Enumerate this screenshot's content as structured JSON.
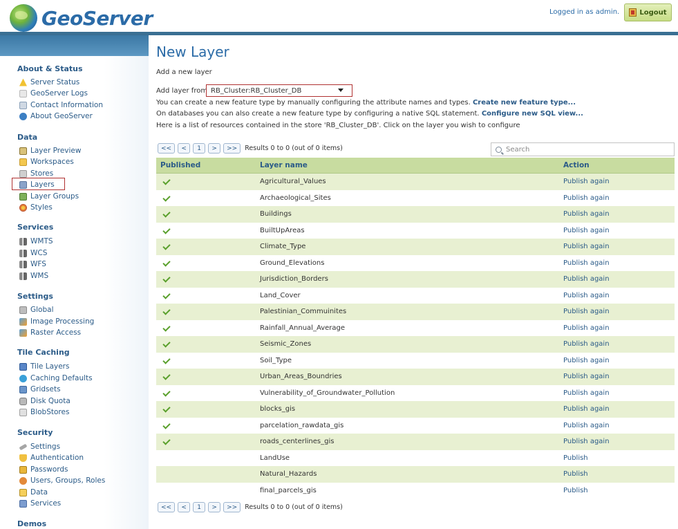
{
  "header": {
    "brand": "GeoServer",
    "logged_in": "Logged in as admin.",
    "logout": "Logout"
  },
  "sidebar": {
    "about": {
      "title": "About & Status",
      "items": [
        "Server Status",
        "GeoServer Logs",
        "Contact Information",
        "About GeoServer"
      ]
    },
    "data": {
      "title": "Data",
      "items": [
        "Layer Preview",
        "Workspaces",
        "Stores",
        "Layers",
        "Layer Groups",
        "Styles"
      ]
    },
    "services": {
      "title": "Services",
      "items": [
        "WMTS",
        "WCS",
        "WFS",
        "WMS"
      ]
    },
    "settings": {
      "title": "Settings",
      "items": [
        "Global",
        "Image Processing",
        "Raster Access"
      ]
    },
    "tile_caching": {
      "title": "Tile Caching",
      "items": [
        "Tile Layers",
        "Caching Defaults",
        "Gridsets",
        "Disk Quota",
        "BlobStores"
      ]
    },
    "security": {
      "title": "Security",
      "items": [
        "Settings",
        "Authentication",
        "Passwords",
        "Users, Groups, Roles",
        "Data",
        "Services"
      ]
    },
    "demos": {
      "title": "Demos"
    }
  },
  "main": {
    "title": "New Layer",
    "subtitle": "Add a new layer",
    "add_from_label": "Add layer from",
    "store_value": "RB_Cluster:RB_Cluster_DB",
    "line1_text": "You can create a new feature type by manually configuring the attribute names and types.",
    "line1_link": "Create new feature type...",
    "line2_text": "On databases you can also create a new feature type by configuring a native SQL statement.",
    "line2_link": "Configure new SQL view...",
    "line3_text": "Here is a list of resources contained in the store 'RB_Cluster_DB'. Click on the layer you wish to configure",
    "pager": {
      "first": "<<",
      "prev": "<",
      "page": "1",
      "next": ">",
      "last": ">>",
      "results": "Results 0 to 0 (out of 0 items)"
    },
    "search_placeholder": "Search",
    "table": {
      "headers": [
        "Published",
        "Layer name",
        "Action"
      ],
      "rows": [
        {
          "published": true,
          "name": "Agricultural_Values",
          "action": "Publish again"
        },
        {
          "published": true,
          "name": "Archaeological_Sites",
          "action": "Publish again"
        },
        {
          "published": true,
          "name": "Buildings",
          "action": "Publish again"
        },
        {
          "published": true,
          "name": "BuiltUpAreas",
          "action": "Publish again"
        },
        {
          "published": true,
          "name": "Climate_Type",
          "action": "Publish again"
        },
        {
          "published": true,
          "name": "Ground_Elevations",
          "action": "Publish again"
        },
        {
          "published": true,
          "name": "Jurisdiction_Borders",
          "action": "Publish again"
        },
        {
          "published": true,
          "name": "Land_Cover",
          "action": "Publish again"
        },
        {
          "published": true,
          "name": "Palestinian_Commuinites",
          "action": "Publish again"
        },
        {
          "published": true,
          "name": "Rainfall_Annual_Average",
          "action": "Publish again"
        },
        {
          "published": true,
          "name": "Seismic_Zones",
          "action": "Publish again"
        },
        {
          "published": true,
          "name": "Soil_Type",
          "action": "Publish again"
        },
        {
          "published": true,
          "name": "Urban_Areas_Boundries",
          "action": "Publish again"
        },
        {
          "published": true,
          "name": "Vulnerability_of_Groundwater_Pollution",
          "action": "Publish again"
        },
        {
          "published": true,
          "name": "blocks_gis",
          "action": "Publish again"
        },
        {
          "published": true,
          "name": "parcelation_rawdata_gis",
          "action": "Publish again"
        },
        {
          "published": true,
          "name": "roads_centerlines_gis",
          "action": "Publish again"
        },
        {
          "published": false,
          "name": "LandUse",
          "action": "Publish"
        },
        {
          "published": false,
          "name": "Natural_Hazards",
          "action": "Publish"
        },
        {
          "published": false,
          "name": "final_parcels_gis",
          "action": "Publish"
        }
      ]
    }
  }
}
